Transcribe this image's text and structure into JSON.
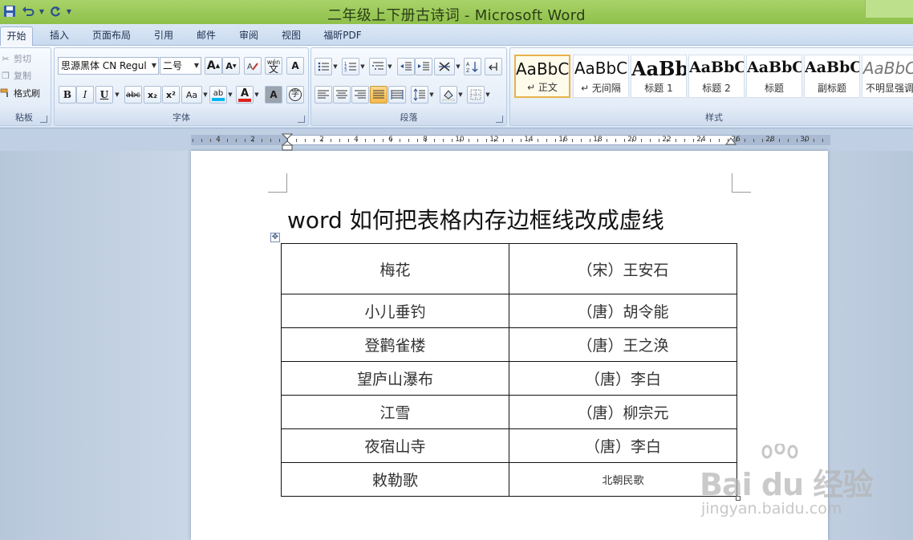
{
  "window": {
    "title": "二年级上下册古诗词 - Microsoft Word"
  },
  "quick_access": {
    "items": [
      "save-icon",
      "undo-icon",
      "redo-icon",
      "customize-icon"
    ]
  },
  "tabs": [
    {
      "label": "开始",
      "active": true
    },
    {
      "label": "插入"
    },
    {
      "label": "页面布局"
    },
    {
      "label": "引用"
    },
    {
      "label": "邮件"
    },
    {
      "label": "审阅"
    },
    {
      "label": "视图"
    },
    {
      "label": "福昕PDF"
    }
  ],
  "clipboard": {
    "cut": "剪切",
    "copy": "复制",
    "format_painter": "格式刷",
    "label": "粘板"
  },
  "font": {
    "family": "思源黑体 CN Regul",
    "size": "二号",
    "grow": "A",
    "shrink": "A",
    "phonetic": "wén",
    "bold": "B",
    "italic": "I",
    "underline": "U",
    "strike": "abc",
    "subscript": "x₂",
    "superscript": "x²",
    "change_case": "Aa",
    "highlight": "ab",
    "font_color": "A",
    "char_shading": "A",
    "enclose": "字",
    "label": "字体",
    "highlight_color": "#00b7f0",
    "font_color_value": "#e0201b"
  },
  "paragraph": {
    "label": "段落"
  },
  "styles": {
    "label": "样式",
    "items": [
      {
        "preview": "AaBbC",
        "name": "↵ 正文"
      },
      {
        "preview": "AaBbC",
        "name": "↵ 无间隔"
      },
      {
        "preview": "AaBb",
        "name": "标题 1"
      },
      {
        "preview": "AaBbC",
        "name": "标题 2"
      },
      {
        "preview": "AaBbC",
        "name": "标题"
      },
      {
        "preview": "AaBbC",
        "name": "副标题"
      },
      {
        "preview": "AaBbC",
        "name": "不明显强调"
      }
    ]
  },
  "ruler": {
    "left_labels": [
      "4",
      "2"
    ],
    "right_labels": [
      "2",
      "4",
      "6",
      "8",
      "10",
      "12",
      "14",
      "16",
      "18",
      "20",
      "22",
      "24",
      "26",
      "28",
      "30"
    ]
  },
  "document": {
    "title": "word 如何把表格内存边框线改成虚线",
    "table": [
      [
        "梅花",
        "（宋）王安石"
      ],
      [
        "小儿垂钓",
        "（唐）胡令能"
      ],
      [
        "登鹳雀楼",
        "（唐）王之涣"
      ],
      [
        "望庐山瀑布",
        "（唐）李白"
      ],
      [
        "江雪",
        "（唐）柳宗元"
      ],
      [
        "夜宿山寺",
        "（唐）李白"
      ],
      [
        "敕勒歌",
        "北朝民歌"
      ]
    ]
  },
  "watermark": {
    "logo": "Bai du 经验",
    "site": "jingyan.baidu.com"
  }
}
